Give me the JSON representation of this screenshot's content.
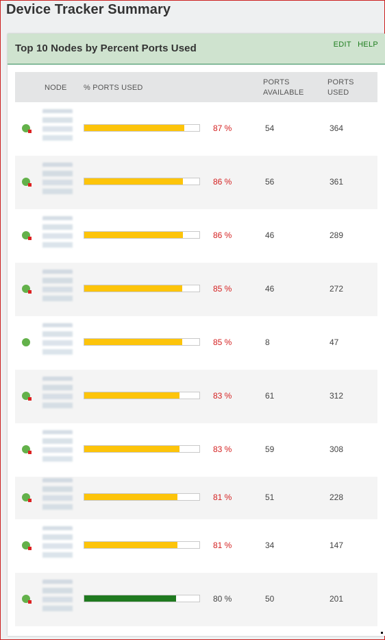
{
  "page": {
    "title": "Device Tracker Summary"
  },
  "panel": {
    "title": "Top 10 Nodes by Percent Ports Used",
    "edit_label": "EDIT",
    "help_label": "HELP"
  },
  "table": {
    "headers": {
      "node": "NODE",
      "percent": "% PORTS USED",
      "available": "PORTS\nAVAILABLE",
      "used": "PORTS\nUSED"
    },
    "rows": [
      {
        "status": "warning",
        "percent": 87,
        "percent_label": "87 %",
        "available": "54",
        "used": "364",
        "bar_color": "#fdc40a"
      },
      {
        "status": "warning",
        "percent": 86,
        "percent_label": "86 %",
        "available": "56",
        "used": "361",
        "bar_color": "#fdc40a"
      },
      {
        "status": "warning",
        "percent": 86,
        "percent_label": "86 %",
        "available": "46",
        "used": "289",
        "bar_color": "#fdc40a"
      },
      {
        "status": "warning",
        "percent": 85,
        "percent_label": "85 %",
        "available": "46",
        "used": "272",
        "bar_color": "#fdc40a"
      },
      {
        "status": "up",
        "percent": 85,
        "percent_label": "85 %",
        "available": "8",
        "used": "47",
        "bar_color": "#fdc40a"
      },
      {
        "status": "warning",
        "percent": 83,
        "percent_label": "83 %",
        "available": "61",
        "used": "312",
        "bar_color": "#fdc40a"
      },
      {
        "status": "warning",
        "percent": 83,
        "percent_label": "83 %",
        "available": "59",
        "used": "308",
        "bar_color": "#fdc40a"
      },
      {
        "status": "warning",
        "percent": 81,
        "percent_label": "81 %",
        "available": "51",
        "used": "228",
        "bar_color": "#fdc40a"
      },
      {
        "status": "warning",
        "percent": 81,
        "percent_label": "81 %",
        "available": "34",
        "used": "147",
        "bar_color": "#fdc40a"
      },
      {
        "status": "warning",
        "percent": 80,
        "percent_label": "80 %",
        "available": "50",
        "used": "201",
        "bar_color": "#1f7a1f"
      }
    ]
  },
  "colors": {
    "header_bg": "#cfe3cf",
    "accent_green": "#1e7d1e",
    "bar_warning": "#fdc40a",
    "bar_normal": "#1f7a1f",
    "critical_text": "#d42020",
    "status_up": "#63b14a",
    "status_flag": "#dd2222"
  }
}
